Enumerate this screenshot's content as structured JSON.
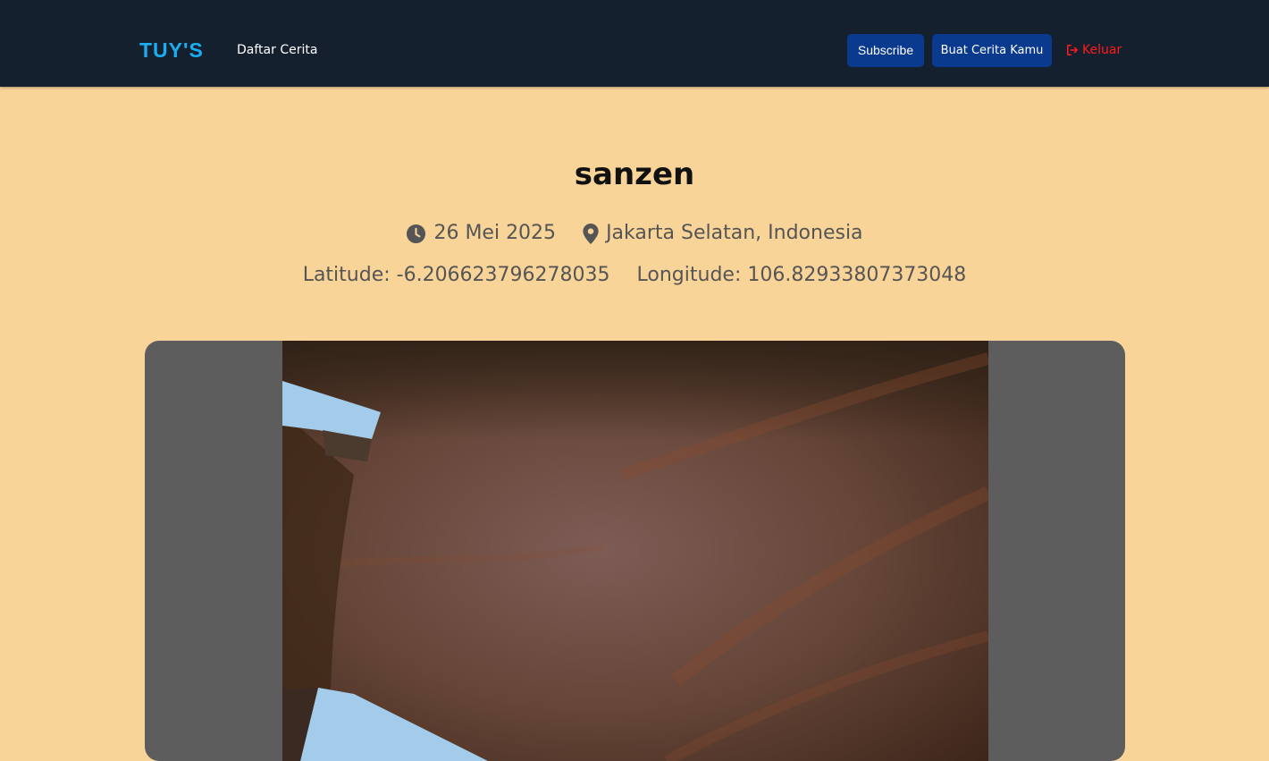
{
  "navbar": {
    "brand": "TUY'S",
    "nav_story_list": "Daftar Cerita",
    "subscribe_label": "Subscribe",
    "create_story_label": "Buat Cerita Kamu",
    "logout_label": "Keluar"
  },
  "story": {
    "title": "sanzen",
    "date": "26 Mei 2025",
    "location": "Jakarta Selatan, Indonesia",
    "latitude": "Latitude: -6.206623796278035",
    "longitude": "Longitude: 106.82933807373048"
  },
  "colors": {
    "navbar_bg": "#15202f",
    "page_bg": "#f9d498",
    "brand": "#1aaef0",
    "button_bg": "#0a3a8e",
    "logout": "#ff1a1a",
    "image_frame_bg": "#5d5d5d"
  },
  "icons": {
    "date": "clock-icon",
    "location": "map-pin-icon",
    "logout": "sign-out-icon"
  }
}
